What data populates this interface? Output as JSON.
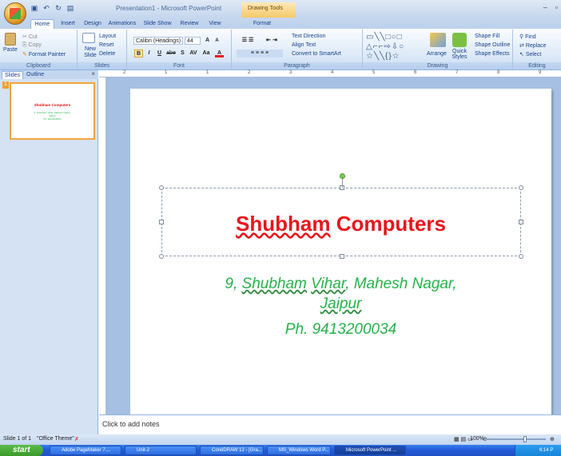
{
  "window": {
    "title": "Presentation1 - Microsoft PowerPoint",
    "contextual_tab": "Drawing Tools",
    "controls": [
      "–",
      "▫"
    ]
  },
  "quick_access": [
    "save-icon",
    "undo-icon",
    "redo-icon",
    "new-slide-icon"
  ],
  "tabs": [
    "Home",
    "Insert",
    "Design",
    "Animations",
    "Slide Show",
    "Review",
    "View",
    "Format"
  ],
  "active_tab": "Home",
  "ribbon": {
    "clipboard": {
      "label": "Clipboard",
      "paste": "Paste",
      "cut": "Cut",
      "copy": "Copy",
      "format_painter": "Format Painter"
    },
    "slides": {
      "label": "Slides",
      "new_slide": "New Slide",
      "layout": "Layout",
      "reset": "Reset",
      "delete": "Delete"
    },
    "font": {
      "label": "Font",
      "font_name": "Calibri (Headings)",
      "font_size": "44",
      "bold": "B",
      "italic": "I",
      "underline": "U",
      "strike": "abe",
      "shadow": "S",
      "spacing": "AV",
      "case": "Aa",
      "color": "A"
    },
    "paragraph": {
      "label": "Paragraph",
      "text_direction": "Text Direction",
      "align_text": "Align Text",
      "smartart": "Convert to SmartArt"
    },
    "drawing": {
      "label": "Drawing",
      "arrange": "Arrange",
      "quick_styles": "Quick Styles",
      "shape_fill": "Shape Fill",
      "shape_outline": "Shape Outline",
      "shape_effects": "Shape Effects"
    },
    "editing": {
      "label": "Editing",
      "find": "Find",
      "replace": "Replace",
      "select": "Select"
    }
  },
  "slides_panel": {
    "tab_slides": "Slides",
    "tab_outline": "Outline",
    "close": "×",
    "slide_number": "1",
    "thumb_title": "Shubham Computers",
    "thumb_sub1": "9, Shubham Vihar, Mahesh Nagar,",
    "thumb_sub2": "Jaipur",
    "thumb_sub3": "Ph. 9413200034"
  },
  "ruler_numbers": [
    "2",
    "1",
    "1",
    "2",
    "3",
    "4",
    "5",
    "6",
    "7",
    "8",
    "9"
  ],
  "slide": {
    "title_pre": "Shubham",
    "title_post": " Computers",
    "line1_pre": "9, ",
    "line1_u1": "Shubham",
    "line1_sp": " ",
    "line1_u2": "Vihar",
    "line1_post": ", Mahesh Nagar,",
    "line2": "Jaipur",
    "line3": "Ph. 9413200034",
    "title_color": "#e8141b",
    "body_color": "#27b14a"
  },
  "notes": {
    "placeholder": "Click to add notes"
  },
  "statusbar": {
    "slide_info": "Slide 1 of 1",
    "theme": "\"Office Theme\"",
    "zoom": "100%"
  },
  "taskbar": {
    "start": "start",
    "items": [
      "Adobe PageMaker 7....",
      "Unit-2",
      "CorelDRAW 12 - [Gra...",
      "MS_Windows Word P...",
      "Microsoft PowerPoint ..."
    ],
    "clock": "6:14 P"
  }
}
